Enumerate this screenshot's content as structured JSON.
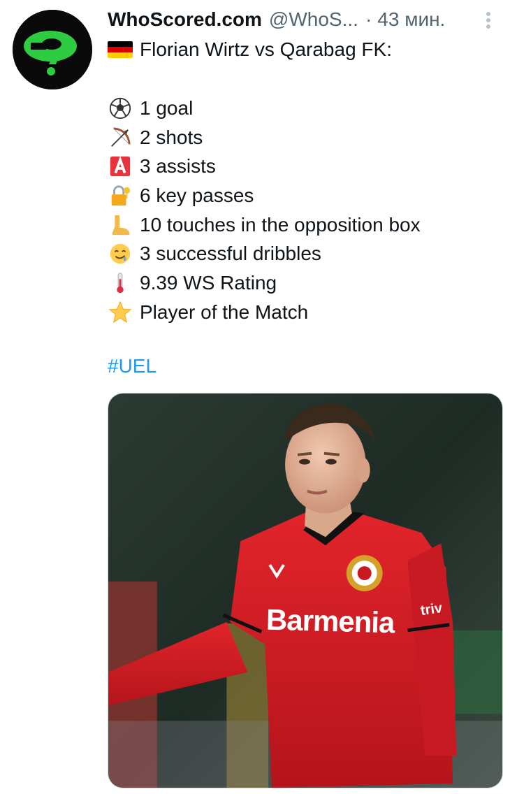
{
  "tweet": {
    "author_name": "WhoScored.com",
    "handle": "@WhoS...",
    "separator": "·",
    "time": "43 мин.",
    "avatar_icon": "question-mark-icon",
    "title_text": "Florian Wirtz vs Qarabag FK:",
    "title_flag": "germany-flag-icon",
    "stats": [
      {
        "icon": "soccer-ball-icon",
        "text": "1 goal"
      },
      {
        "icon": "bow-and-arrow-icon",
        "text": "2 shots"
      },
      {
        "icon": "letter-a-button-icon",
        "text": "3 assists"
      },
      {
        "icon": "locked-with-key-icon",
        "text": "6 key passes"
      },
      {
        "icon": "foot-icon",
        "text": "10 touches in the opposition box"
      },
      {
        "icon": "drooling-face-icon",
        "text": "3 successful dribbles"
      },
      {
        "icon": "thermometer-icon",
        "text": "9.39 WS Rating"
      },
      {
        "icon": "star-icon",
        "text": "Player of the Match"
      }
    ],
    "hashtag": "#UEL",
    "media": {
      "sponsor_text": "Barmenia",
      "sleeve_text": "triv"
    }
  },
  "colors": {
    "link": "#1d9bf0",
    "secondary_text": "#536471",
    "avatar_bg": "#0a0a0a",
    "avatar_icon": "#2ecc40",
    "kit_red": "#d61f26"
  }
}
